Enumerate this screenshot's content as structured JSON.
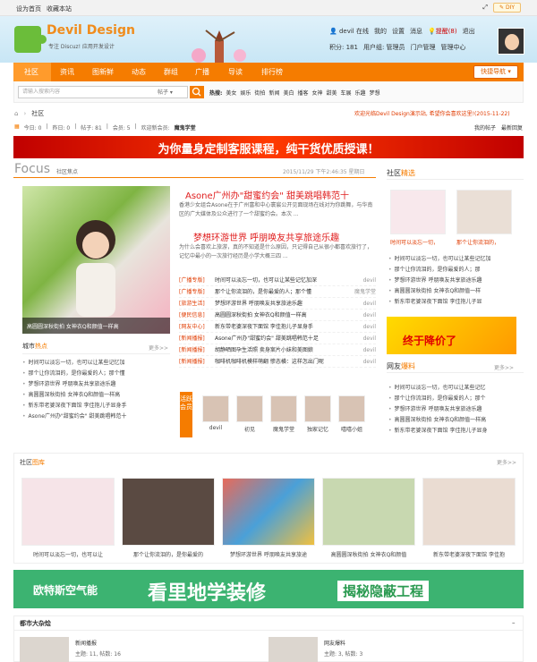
{
  "topbar": {
    "left": [
      "设为首页",
      "收藏本站"
    ],
    "diy": "DIY"
  },
  "logo": {
    "title": "Devil Design",
    "sub": "专注 Discuz! 应用开发设计"
  },
  "user": {
    "name": "devil",
    "online": "在线",
    "my": "我的",
    "settings": "设置",
    "messages": "消息",
    "reminder": "提醒(8)",
    "logout": "退出",
    "points": "积分: 181",
    "group": "用户组: 管理员",
    "portal": "门户管理",
    "admin": "管理中心"
  },
  "nav": {
    "items": [
      "社区",
      "资讯",
      "图新鲜",
      "动态",
      "群组",
      "广播",
      "导读",
      "排行榜"
    ],
    "quick": "快捷导航"
  },
  "search": {
    "placeholder": "请输入搜索内容",
    "scope": "帖子",
    "hot_label": "热搜:",
    "hot": [
      "美女",
      "娱乐",
      "街拍",
      "新闻",
      "美白",
      "播客",
      "女神",
      "甜美",
      "车展",
      "乐趣",
      "梦想"
    ]
  },
  "crumb": {
    "home_label": "社区",
    "welcome": "欢迎光临Devil Design演示站, 希望你会喜欢这里!(2015-11-22)"
  },
  "stats": {
    "today": "今日: 0",
    "yesterday": "昨日: 0",
    "posts": "帖子: 81",
    "members": "会员: 5",
    "newest": "欢迎新会员:",
    "newest_name": "魔鬼学堂",
    "my_posts": "我的帖子",
    "latest": "最新回复"
  },
  "banner1": "为你量身定制客服课程，纯干货优质授课！",
  "focus": {
    "title": "Focus",
    "sub": "社区焦点",
    "date": "2015/11/29 下午2:46:35 星期日",
    "main_caption": "高圆圆深秋街拍 女神衣Q和颜值一样高",
    "headline1": "Asone广州办\"甜蜜约会\" 甜美跳唱韩范十",
    "desc1": "香港少女组合Asone在于广州富和中心寰宸公开见面现场在线对为你跳舞，与华南区的广大媒体及公众进行了一个甜蜜约会。本次 ...",
    "headline2": "梦想环游世界 呼朋唤友共享旅途乐趣",
    "desc2": "为什么会喜欢上旅游，真的不知道是什么原因，只记得自己从很小都喜欢旅行了，记忆中最小的一次旅行经历是小学大概三四 ..."
  },
  "news": [
    {
      "tag": "[广播专版]",
      "title": "时间可以淡忘一切，也可以让某些记忆加深",
      "author": "devil"
    },
    {
      "tag": "[广播专版]",
      "title": "那个让你流泪的，是你最爱的人；那个懂",
      "author": "魔鬼学堂"
    },
    {
      "tag": "[旅游生活]",
      "title": "梦想环游世界 呼朋唤友共享旅途乐趣",
      "author": "devil"
    },
    {
      "tag": "[便民信息]",
      "title": "高圆圆深秋街拍 女神衣Q和颜值一样高",
      "author": "devil"
    },
    {
      "tag": "[网友中心]",
      "title": "新东带老婆深夜下面馆 李佳抱儿子显身手",
      "author": "devil"
    },
    {
      "tag": "[新闻播报]",
      "title": "Asone广州办\"甜蜜约会\" 甜美跳唱韩范十足",
      "author": "devil"
    },
    {
      "tag": "[新闻播报]",
      "title": "胡静晒图孕生活照 卖身案片小妹和美图娘",
      "author": "devil"
    },
    {
      "tag": "[新闻播报]",
      "title": "咖啡机咖啡机模样萌翻 惨态横：这样怎出门呢",
      "author": "devil"
    }
  ],
  "cityhot": {
    "title": "城市",
    "title_hl": "热点",
    "more": "更多>>",
    "items": [
      "时间可以淡忘一切，也可以让某些记忆加",
      "那个让你流泪的，是你最爱的人；那个懂",
      "梦想环游世界 呼朋唤友共享旅途乐趣",
      "高圆圆深秋街拍 女神衣Q和颜值一样高",
      "新东带老婆深夜下面馆 李佳抱儿子显身手",
      "Asone广州办\"甜蜜约会\" 甜美跳唱韩范十"
    ]
  },
  "members": {
    "tag": "活跃会员",
    "items": [
      "devil",
      "初见",
      "魔鬼学堂",
      "独家记忆",
      "嘻嘻小姐"
    ]
  },
  "community": {
    "title": "社区",
    "title_hl": "精选",
    "caps": [
      "时间可以淡忘一切，",
      "那个让你流泪的，"
    ],
    "items": [
      "时间可以淡忘一切，也可以让某些记忆加",
      "那个让你流泪的，是你最爱的人；那",
      "梦想环游世界 呼朋唤友共享旅途乐趣",
      "高圆圆深秋街拍 女神衣Q和颜值一样",
      "新东带老婆深夜下面馆 李佳抱儿子显"
    ]
  },
  "promo": "终于降价了",
  "netnews": {
    "title": "网友",
    "title_hl": "爆料",
    "more": "更多>>",
    "items": [
      "时间可以淡忘一切，也可以让某些记忆",
      "那个让你流泪的，是你最爱的人；那个",
      "梦想环游世界 呼朋唤友共享旅途乐趣",
      "高圆圆深秋街拍 女神衣Q和颜值一样高",
      "新东带老婆深夜下面馆 李佳抱儿子显身"
    ]
  },
  "gallery": {
    "title": "社区",
    "title_hl": "图库",
    "more": "更多>>",
    "items": [
      "时间可以淡忘一切，也可以让",
      "那个让你流泪的，是你最爱的",
      "梦想环游世界 呼朋唤友共享旅途",
      "高圆圆深秋街拍 女神衣Q和颜值",
      "新东带老婆深夜下面馆 李佳抱"
    ]
  },
  "banner2": {
    "a": "欧特斯空气能",
    "b": "看里地学装修",
    "c": "揭秘隐蔽工程"
  },
  "bottom": {
    "title": "都市大杂烩",
    "min": "–",
    "col1": {
      "name": "新闻播报",
      "stats": "主题: 11, 帖数: 16"
    },
    "col2": {
      "name": "网友爆料",
      "stats": "主题: 3, 帖数: 3"
    }
  }
}
